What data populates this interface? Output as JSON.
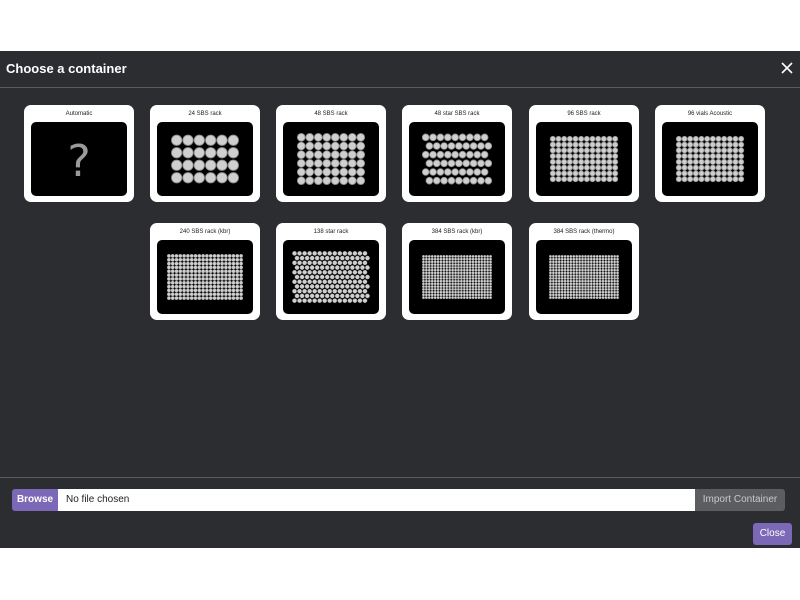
{
  "dialog": {
    "title": "Choose a container",
    "close_icon": "close-icon"
  },
  "containers": [
    {
      "label": "Automatic",
      "icon": "question-mark-icon"
    },
    {
      "label": "24 SBS rack",
      "icon": "rack-24-icon"
    },
    {
      "label": "48 SBS rack",
      "icon": "rack-48-icon"
    },
    {
      "label": "48 star SBS rack",
      "icon": "rack-48-star-icon"
    },
    {
      "label": "96 SBS rack",
      "icon": "rack-96-icon"
    },
    {
      "label": "96 vials Acoustic",
      "icon": "rack-96-vials-icon"
    },
    {
      "label": "240 SBS rack (kbr)",
      "icon": "rack-240-icon"
    },
    {
      "label": "138 star rack",
      "icon": "rack-138-star-icon"
    },
    {
      "label": "384 SBS rack (kbr)",
      "icon": "rack-384-kbr-icon"
    },
    {
      "label": "384 SBS rack (thermo)",
      "icon": "rack-384-thermo-icon"
    }
  ],
  "file_picker": {
    "browse_label": "Browse",
    "file_value": "No file chosen",
    "import_label": "Import Container"
  },
  "footer": {
    "close_label": "Close"
  },
  "colors": {
    "dialog_bg": "#2c2d30",
    "accent": "#7b68b6",
    "disabled_button": "#5c5d60"
  }
}
